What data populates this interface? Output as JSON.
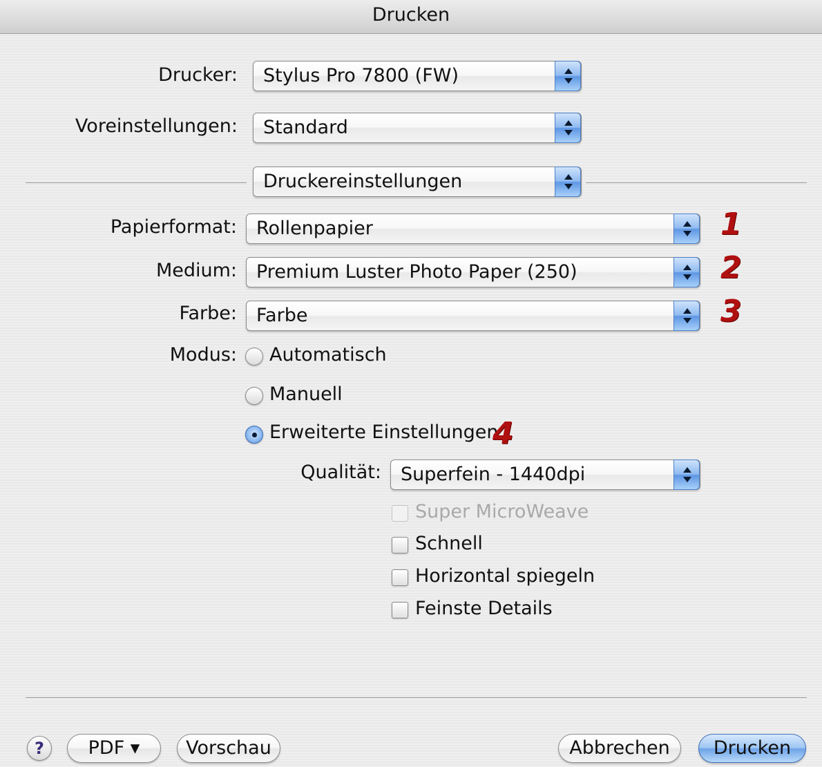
{
  "window": {
    "title": "Drucken"
  },
  "printer": {
    "label": "Drucker:",
    "value": "Stylus Pro 7800 (FW)"
  },
  "presets": {
    "label": "Voreinstellungen:",
    "value": "Standard"
  },
  "panel": {
    "value": "Druckereinstellungen"
  },
  "paper_format": {
    "label": "Papierformat:",
    "value": "Rollenpapier",
    "marker": "1"
  },
  "medium": {
    "label": "Medium:",
    "value": "Premium Luster Photo Paper (250)",
    "marker": "2"
  },
  "color": {
    "label": "Farbe:",
    "value": "Farbe",
    "marker": "3"
  },
  "mode": {
    "label": "Modus:",
    "options": [
      {
        "label": "Automatisch",
        "selected": false
      },
      {
        "label": "Manuell",
        "selected": false
      },
      {
        "label": "Erweiterte Einstellungen",
        "selected": true
      }
    ],
    "marker": "4"
  },
  "quality": {
    "label": "Qualität:",
    "value": "Superfein - 1440dpi"
  },
  "checkboxes": [
    {
      "label": "Super MicroWeave",
      "checked": false,
      "enabled": false
    },
    {
      "label": "Schnell",
      "checked": false,
      "enabled": true
    },
    {
      "label": "Horizontal spiegeln",
      "checked": false,
      "enabled": true
    },
    {
      "label": "Feinste Details",
      "checked": false,
      "enabled": true
    }
  ],
  "footer": {
    "help": "?",
    "pdf": "PDF ▾",
    "preview": "Vorschau",
    "cancel": "Abbrechen",
    "print": "Drucken"
  },
  "accent_colors": {
    "marker": "#b01010",
    "selection": "#6ea3e8"
  }
}
